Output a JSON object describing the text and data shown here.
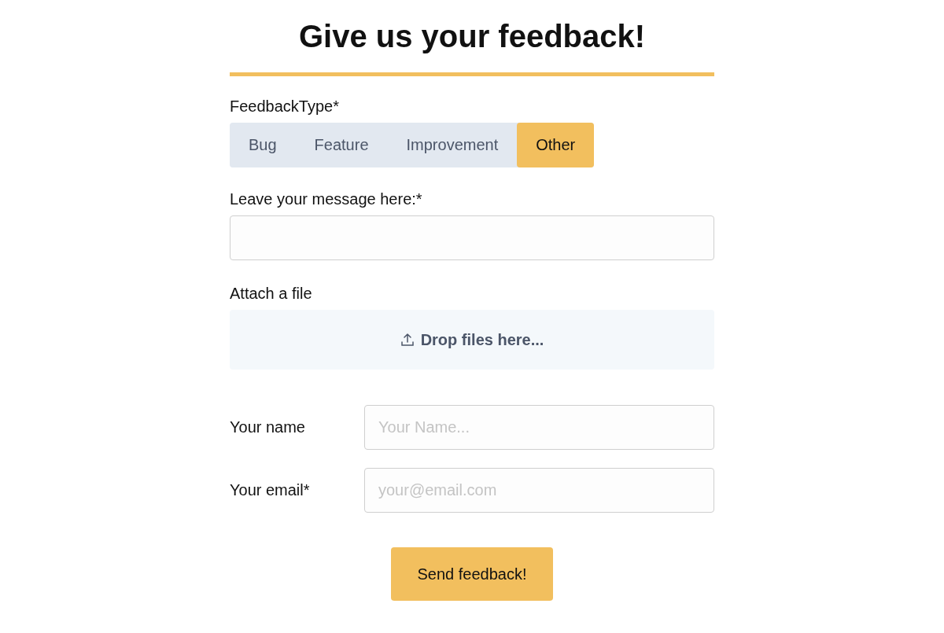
{
  "title": "Give us your feedback!",
  "feedback_type": {
    "label": "FeedbackType*",
    "options": [
      {
        "label": "Bug",
        "selected": false
      },
      {
        "label": "Feature",
        "selected": false
      },
      {
        "label": "Improvement",
        "selected": false
      },
      {
        "label": "Other",
        "selected": true
      }
    ]
  },
  "message": {
    "label": "Leave your message here:*"
  },
  "attachment": {
    "label": "Attach a file",
    "dropzone": "Drop files here..."
  },
  "name": {
    "label": "Your name",
    "placeholder": "Your Name..."
  },
  "email": {
    "label": "Your email*",
    "placeholder": "your@email.com"
  },
  "submit": "Send feedback!"
}
